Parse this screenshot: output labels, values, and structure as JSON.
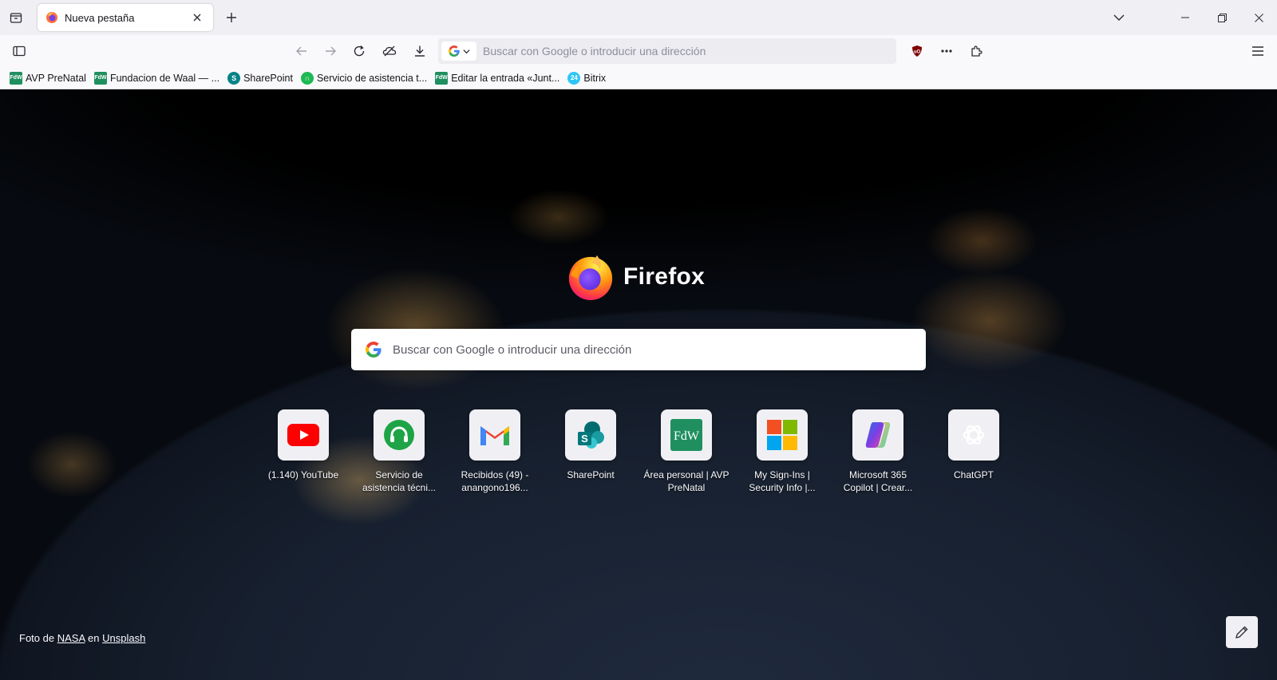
{
  "window": {
    "tab_title": "Nueva pestaña"
  },
  "navbar": {
    "url_placeholder": "Buscar con Google o introducir una dirección"
  },
  "bookmarks": [
    {
      "label": "AVP PreNatal",
      "icon": "fdw-icon",
      "color": "#1f8f5f"
    },
    {
      "label": "Fundacion de Waal — ...",
      "icon": "fdw-icon",
      "color": "#1f8f5f"
    },
    {
      "label": "SharePoint",
      "icon": "sharepoint-icon",
      "color": "#038387"
    },
    {
      "label": "Servicio de asistencia t...",
      "icon": "headset-icon",
      "color": "#1db954"
    },
    {
      "label": "Editar la entrada «Junt...",
      "icon": "fdw-icon",
      "color": "#1f8f5f"
    },
    {
      "label": "Bitrix",
      "icon": "bitrix-icon",
      "color": "#2fc6f6"
    }
  ],
  "newtab": {
    "brand": "Firefox",
    "search_placeholder": "Buscar con Google o introducir una dirección",
    "tiles": [
      {
        "label": "(1.140) YouTube",
        "icon": "youtube-icon"
      },
      {
        "label": "Servicio de asistencia técni...",
        "icon": "headset-icon"
      },
      {
        "label": "Recibidos (49) - anangono196...",
        "icon": "gmail-icon"
      },
      {
        "label": "SharePoint",
        "icon": "sharepoint-icon"
      },
      {
        "label": "Área personal | AVP PreNatal",
        "icon": "fdw-icon"
      },
      {
        "label": "My Sign-Ins | Security Info |...",
        "icon": "microsoft-icon"
      },
      {
        "label": "Microsoft 365 Copilot | Crear...",
        "icon": "copilot-icon"
      },
      {
        "label": "ChatGPT",
        "icon": "chatgpt-icon"
      }
    ],
    "credit_prefix": "Foto de",
    "credit_author": "NASA",
    "credit_middle": "en",
    "credit_site": "Unsplash"
  },
  "colors": {
    "chrome": "#f0f0f4",
    "toolbar": "#f9f9fb",
    "ublock": "#800000"
  }
}
